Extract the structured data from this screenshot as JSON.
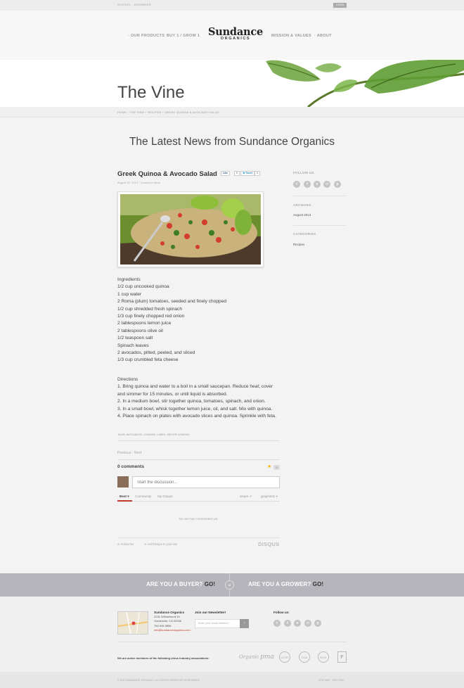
{
  "topbar": {
    "left_text": "SCHOOL · GROWERS",
    "login": "LOGIN"
  },
  "nav": {
    "our_products": "· OUR PRODUCTS",
    "buy_grow": "BUY 1 / GROW 1",
    "mission": "MISSION & VALUES",
    "about": "· ABOUT"
  },
  "logo": {
    "line1": "Sundance",
    "line2": "ORGANICS"
  },
  "hero": {
    "title": "The Vine"
  },
  "breadcrumb": "HOME  ›  THE VINE  ›  RECIPES  ›  GREEK QUINOA & AVOCADO SALAD",
  "section_title": "The Latest News from Sundance Organics",
  "post": {
    "title": "Greek Quinoa & Avocado Salad",
    "fb_like": "Like",
    "fb_count": "0",
    "tweet": "Tweet",
    "tweet_count": "0",
    "meta": "August 20, 2013  ·  Customer  News",
    "ingredients": [
      "Ingredients",
      "1/2 cup uncooked quinoa",
      "1 cup water",
      "2 Roma (plum) tomatoes, seeded and finely chopped",
      "1/2 cup shredded fresh spinach",
      "1/3 cup finely chopped red onion",
      "2 tablespoons lemon juice",
      "2 tablespoons olive oil",
      "1/2 teaspoon salt",
      "Spinach leaves",
      "2 avocados, pitted, peeled, and sliced",
      "1/3 cup crumbled feta cheese"
    ],
    "directions": [
      "Directions",
      "1. Bring quinoa and water to a boil in a small saucepan. Reduce heat; cover",
      "and simmer for 15 minutes, or until liquid is absorbed.",
      "2. In a medium bowl, stir together quinoa, tomatoes, spinach, and onion.",
      "3. In a small bowl, whisk together lemon juice, oil, and salt. Mix with quinoa.",
      "4. Place spinach on plates with avocado slices and quinoa. Sprinkle with feta."
    ],
    "tags": "TAGS: AVOCADOS, LEMONS, LIMES, MEYER LEMONS",
    "prev_next": "Previous  ·  Next"
  },
  "comments": {
    "count_label": "0 comments",
    "star_count": "0",
    "placeholder": "Start the discussion...",
    "tab_best": "Best ▾",
    "tab_community": "Community",
    "tab_my": "My Disqus",
    "share": "Share ⇗",
    "user": "graphik01 ▾",
    "empty": "No one has commented yet.",
    "subscribe": "✉  Subscribe",
    "add_disqus": "⊕  Add Disqus to your site",
    "brand": "DISQUS"
  },
  "sidebar": {
    "follow_title": "FOLLOW US",
    "archives_title": "ARCHIVES",
    "archive_item": "August 2013",
    "categories_title": "CATEGORIES",
    "category_item": "Recipes"
  },
  "band": {
    "buyer": "ARE YOU A BUYER?",
    "buyer_go": "GO!",
    "or": "or",
    "grower": "ARE YOU A GROWER?",
    "grower_go": "GO!"
  },
  "footer": {
    "company": "Sundance Organics",
    "address1": "2231 Willowbrook Dr",
    "address2": "Oceanside, CA 92056",
    "phone": "760.945.9898",
    "email": "info@sundanceorganics.com",
    "newsletter_title": "Join our Newsletter!",
    "email_placeholder": "Enter your email address*",
    "go": "›",
    "follow": "Follow us:",
    "associations": "We are active members of the following citrus industry associations:",
    "assoc_logos": [
      "Organic",
      "pma",
      "CCOF",
      "CGA",
      "SEAL",
      "F"
    ],
    "copyright": "© 2013 SUNDANCE ORGANICS. ALL RIGHTS RESERVED WORLDWIDE.",
    "right_links": "SITE MAP  ·  RSS FEED"
  },
  "colors": {
    "accent": "#c0392b",
    "band": "#b5b5bb",
    "star": "#f0b400"
  }
}
